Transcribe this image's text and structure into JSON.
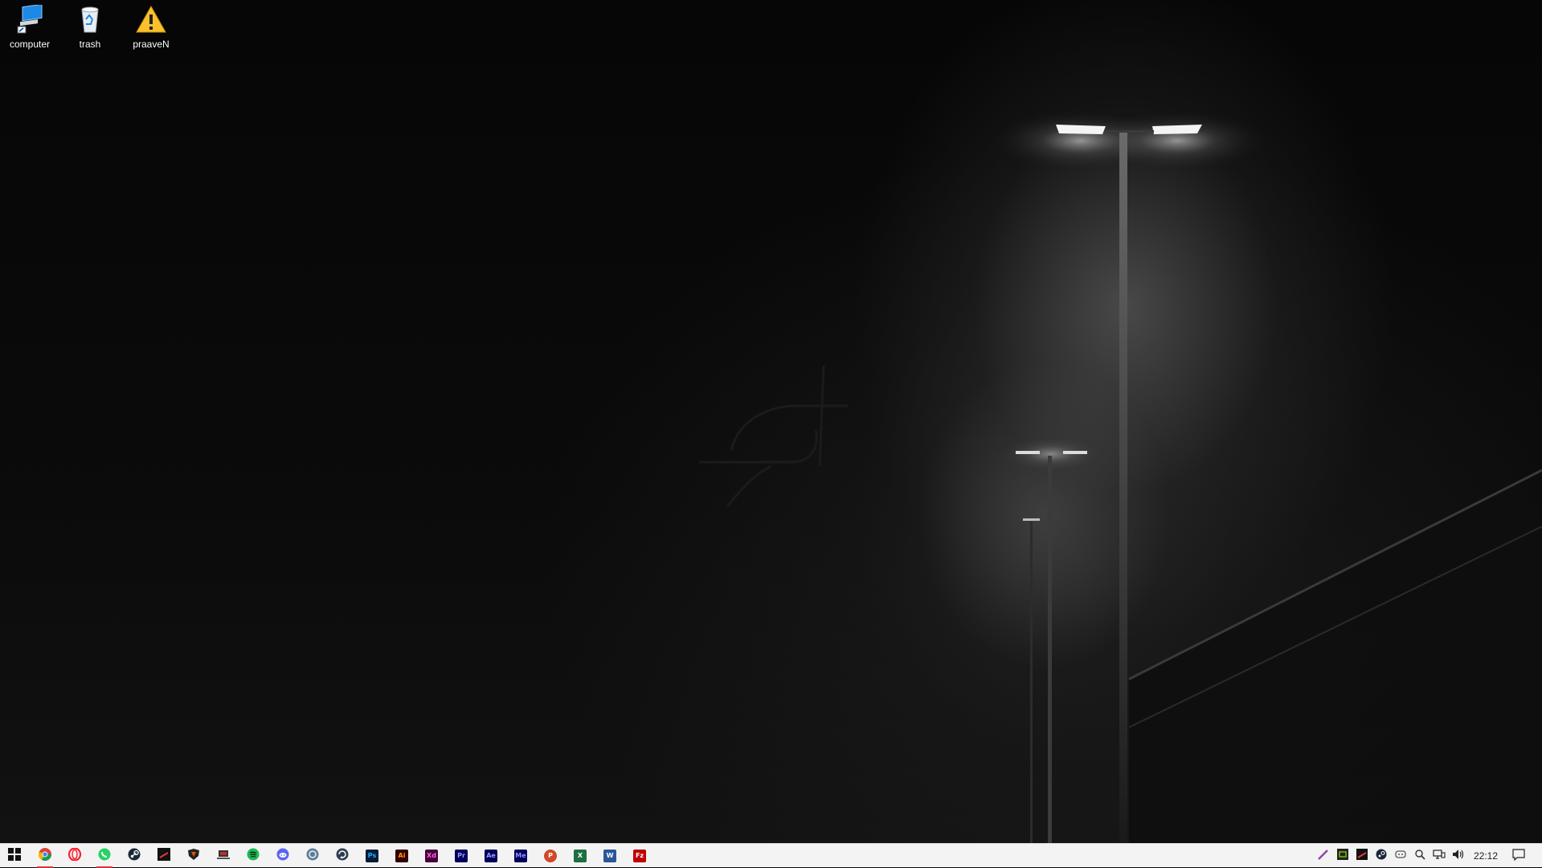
{
  "desktop": {
    "icons": [
      {
        "label": "computer",
        "icon": "computer-icon"
      },
      {
        "label": "trash",
        "icon": "recycle-bin-icon"
      },
      {
        "label": "praaveN",
        "icon": "warning-icon"
      }
    ]
  },
  "taskbar": {
    "start": {
      "icon": "windows-logo-icon"
    },
    "pinned": [
      {
        "name": "chrome",
        "icon": "chrome-icon",
        "running": true
      },
      {
        "name": "opera",
        "icon": "opera-icon",
        "running": false
      },
      {
        "name": "whatsapp",
        "icon": "whatsapp-icon",
        "running": true
      },
      {
        "name": "steam",
        "icon": "steam-icon",
        "running": false
      },
      {
        "name": "app-dark",
        "icon": "dark-app-icon",
        "running": false
      },
      {
        "name": "shield-app",
        "icon": "shield-app-icon",
        "running": false
      },
      {
        "name": "app-laptop",
        "icon": "laptop-app-icon",
        "running": false
      },
      {
        "name": "spotify",
        "icon": "spotify-icon",
        "running": false
      },
      {
        "name": "discord",
        "icon": "discord-icon",
        "running": false
      },
      {
        "name": "app-circle",
        "icon": "circle-app-icon",
        "running": false
      },
      {
        "name": "app-refresh",
        "icon": "refresh-app-icon",
        "running": false
      },
      {
        "name": "photoshop",
        "icon": "photoshop-icon",
        "label": "Ps",
        "running": false
      },
      {
        "name": "illustrator",
        "icon": "illustrator-icon",
        "label": "Ai",
        "running": false
      },
      {
        "name": "xd",
        "icon": "xd-icon",
        "label": "Xd",
        "running": false
      },
      {
        "name": "premiere",
        "icon": "premiere-icon",
        "label": "Pr",
        "running": false
      },
      {
        "name": "after-effects",
        "icon": "after-effects-icon",
        "label": "Ae",
        "running": false
      },
      {
        "name": "media-encoder",
        "icon": "media-encoder-icon",
        "label": "Me",
        "running": false
      },
      {
        "name": "powerpoint",
        "icon": "powerpoint-icon",
        "label": "P",
        "running": false
      },
      {
        "name": "excel",
        "icon": "excel-icon",
        "label": "X",
        "running": false
      },
      {
        "name": "word",
        "icon": "word-icon",
        "label": "W",
        "running": false
      },
      {
        "name": "filezilla",
        "icon": "filezilla-icon",
        "label": "Fz",
        "running": false
      }
    ],
    "tray": [
      {
        "icon": "pen-icon"
      },
      {
        "icon": "nvidia-icon"
      },
      {
        "icon": "dark-tray-app-icon"
      },
      {
        "icon": "steam-tray-icon"
      },
      {
        "icon": "discord-tray-icon"
      },
      {
        "icon": "search-tray-icon"
      },
      {
        "icon": "network-icon"
      },
      {
        "icon": "volume-icon"
      }
    ],
    "clock": "22:12",
    "notification": {
      "icon": "notification-icon"
    }
  },
  "colors": {
    "taskbar_bg": "#f3f3f3",
    "running_indicator": "#dd3333",
    "ps": "#001e36",
    "ai": "#330000",
    "xd": "#470137",
    "pr": "#00005b",
    "ae": "#00005b",
    "me": "#00005b",
    "ppt": "#d24726",
    "xls": "#1d6f42",
    "doc": "#2b579a",
    "fz": "#bf0000"
  }
}
